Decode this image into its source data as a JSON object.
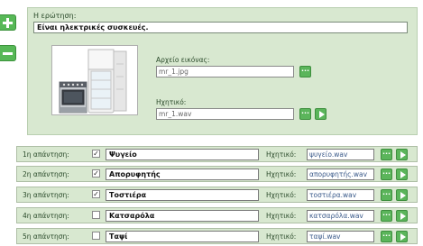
{
  "question": {
    "label": "Η ερώτηση:",
    "value": "Είναι ηλεκτρικές συσκευές."
  },
  "image": {
    "label": "Αρχείο εικόνας:",
    "value": "mr_1.jpg",
    "browse": "..."
  },
  "sound": {
    "label": "Ηχητικό:",
    "value": "mr_1.wav",
    "browse": "..."
  },
  "answers": [
    {
      "label": "1η απάντηση:",
      "checked": true,
      "value": "Ψυγείο",
      "sound_label": "Ηχητικό:",
      "sound": "ψυγείο.wav",
      "browse": "..."
    },
    {
      "label": "2η απάντηση:",
      "checked": true,
      "value": "Απορυφητής",
      "sound_label": "Ηχητικό:",
      "sound": "απορυφητής.wav",
      "browse": "..."
    },
    {
      "label": "3η απάντηση:",
      "checked": true,
      "value": "Τοστιέρα",
      "sound_label": "Ηχητικό:",
      "sound": "τοστιέρα.wav",
      "browse": "..."
    },
    {
      "label": "4η απάντηση:",
      "checked": false,
      "value": "Κατσαρόλα",
      "sound_label": "Ηχητικό:",
      "sound": "κατσαρόλα.wav",
      "browse": "..."
    },
    {
      "label": "5η απάντηση:",
      "checked": false,
      "value": "Ταψί",
      "sound_label": "Ηχητικό:",
      "sound": "ταψί.wav",
      "browse": "..."
    }
  ],
  "check_mark": "✓",
  "colors": {
    "panel": "#d8e8d0",
    "accent": "#5bb55b"
  }
}
